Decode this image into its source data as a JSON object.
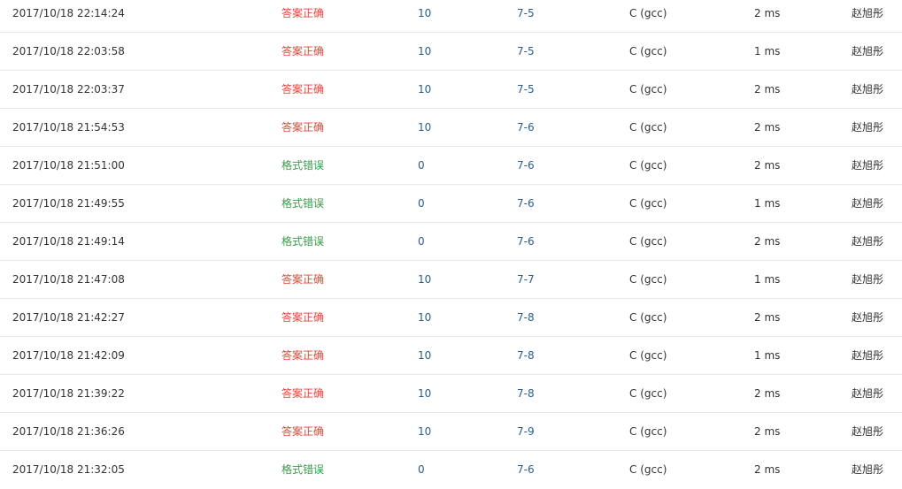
{
  "colors": {
    "correct": "#e0473a",
    "format_error": "#3a9a4a",
    "link": "#2a5d8c",
    "text": "#333333",
    "divider": "#e8e8e8"
  },
  "rows": [
    {
      "time": "2017/10/18 22:14:24",
      "status": "答案正确",
      "status_kind": "correct",
      "score": "10",
      "problem": "7-5",
      "lang": "C (gcc)",
      "runtime": "2 ms",
      "user": "赵旭彤"
    },
    {
      "time": "2017/10/18 22:03:58",
      "status": "答案正确",
      "status_kind": "correct",
      "score": "10",
      "problem": "7-5",
      "lang": "C (gcc)",
      "runtime": "1 ms",
      "user": "赵旭彤"
    },
    {
      "time": "2017/10/18 22:03:37",
      "status": "答案正确",
      "status_kind": "correct",
      "score": "10",
      "problem": "7-5",
      "lang": "C (gcc)",
      "runtime": "2 ms",
      "user": "赵旭彤"
    },
    {
      "time": "2017/10/18 21:54:53",
      "status": "答案正确",
      "status_kind": "correct",
      "score": "10",
      "problem": "7-6",
      "lang": "C (gcc)",
      "runtime": "2 ms",
      "user": "赵旭彤"
    },
    {
      "time": "2017/10/18 21:51:00",
      "status": "格式错误",
      "status_kind": "format",
      "score": "0",
      "problem": "7-6",
      "lang": "C (gcc)",
      "runtime": "2 ms",
      "user": "赵旭彤"
    },
    {
      "time": "2017/10/18 21:49:55",
      "status": "格式错误",
      "status_kind": "format",
      "score": "0",
      "problem": "7-6",
      "lang": "C (gcc)",
      "runtime": "1 ms",
      "user": "赵旭彤"
    },
    {
      "time": "2017/10/18 21:49:14",
      "status": "格式错误",
      "status_kind": "format",
      "score": "0",
      "problem": "7-6",
      "lang": "C (gcc)",
      "runtime": "2 ms",
      "user": "赵旭彤"
    },
    {
      "time": "2017/10/18 21:47:08",
      "status": "答案正确",
      "status_kind": "correct",
      "score": "10",
      "problem": "7-7",
      "lang": "C (gcc)",
      "runtime": "1 ms",
      "user": "赵旭彤"
    },
    {
      "time": "2017/10/18 21:42:27",
      "status": "答案正确",
      "status_kind": "correct",
      "score": "10",
      "problem": "7-8",
      "lang": "C (gcc)",
      "runtime": "2 ms",
      "user": "赵旭彤"
    },
    {
      "time": "2017/10/18 21:42:09",
      "status": "答案正确",
      "status_kind": "correct",
      "score": "10",
      "problem": "7-8",
      "lang": "C (gcc)",
      "runtime": "1 ms",
      "user": "赵旭彤"
    },
    {
      "time": "2017/10/18 21:39:22",
      "status": "答案正确",
      "status_kind": "correct",
      "score": "10",
      "problem": "7-8",
      "lang": "C (gcc)",
      "runtime": "2 ms",
      "user": "赵旭彤"
    },
    {
      "time": "2017/10/18 21:36:26",
      "status": "答案正确",
      "status_kind": "correct",
      "score": "10",
      "problem": "7-9",
      "lang": "C (gcc)",
      "runtime": "2 ms",
      "user": "赵旭彤"
    },
    {
      "time": "2017/10/18 21:32:05",
      "status": "格式错误",
      "status_kind": "format",
      "score": "0",
      "problem": "7-6",
      "lang": "C (gcc)",
      "runtime": "2 ms",
      "user": "赵旭彤"
    }
  ]
}
